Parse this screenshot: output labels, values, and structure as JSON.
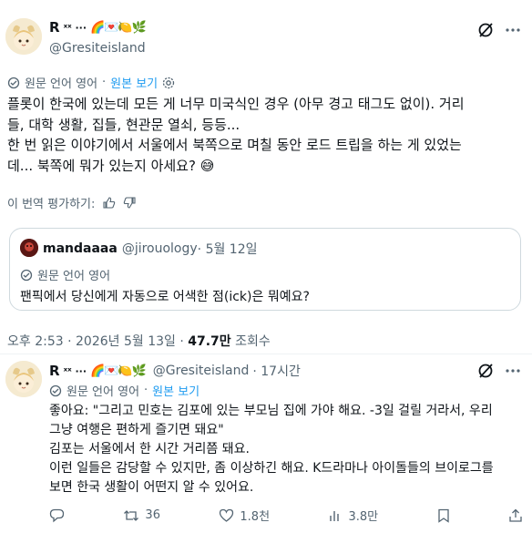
{
  "tweet": {
    "author_name": "R",
    "author_name_suffix": "ˣˣ ···",
    "author_emojis": "🌈💌🍋🌿",
    "handle": "@Gresiteisland",
    "translation_notice": "원문 언어 영어",
    "view_original": "원본 보기",
    "lines": [
      "플롯이 한국에 있는데 모든 게 너무 미국식인 경우 (아무 경고 태그도 없이). 거리",
      "들, 대학 생활, 집들, 현관문 열쇠, 등등...",
      "한 번 읽은 이야기에서 서울에서 북쪽으로 며칠 동안 로드 트립을 하는 게 있었는",
      "데... 북쪽에 뭐가 있는지 아세요? 😅"
    ],
    "rate_translation": "이 번역 평가하기:",
    "timestamp": "오후 2:53 · 2026년 5월 13일 · ",
    "views_count": "47.7만",
    "views_label": " 조회수"
  },
  "quoted": {
    "author_name": "mandaaaa",
    "handle": "@jirouology",
    "date": " · 5월 12일",
    "translation_notice": "원문 언어 영어",
    "text": "팬픽에서 당신에게 자동으로 어색한 점(ick)은 뭐예요?"
  },
  "reply": {
    "author_name": "R",
    "author_name_suffix": "ˣˣ ···",
    "author_emojis": "🌈💌🍋🌿",
    "handle": "@Gresiteisland",
    "time": " · 17시간",
    "translation_notice": "원문 언어 영어",
    "view_original": "원본 보기",
    "lines": [
      "좋아요: \"그리고 민호는 김포에 있는 부모님 집에 가야 해요. -3일 걸릴 거라서, 우리",
      "그냥 여행은 편하게 즐기면 돼요\"",
      "김포는 서울에서 한 시간 거리쯤 돼요.",
      "이런 일들은 감당할 수 있지만, 좀 이상하긴 해요. K드라마나 아이돌들의 브이로그를",
      "보면 한국 생활이 어떤지 알 수 있어요."
    ],
    "actions": {
      "retweets": "36",
      "likes": "1.8천",
      "views": "3.8만"
    }
  },
  "colors": {
    "text": "#0f1419",
    "muted": "#536471",
    "link": "#1d9bf0",
    "border": "#cfd9de"
  }
}
